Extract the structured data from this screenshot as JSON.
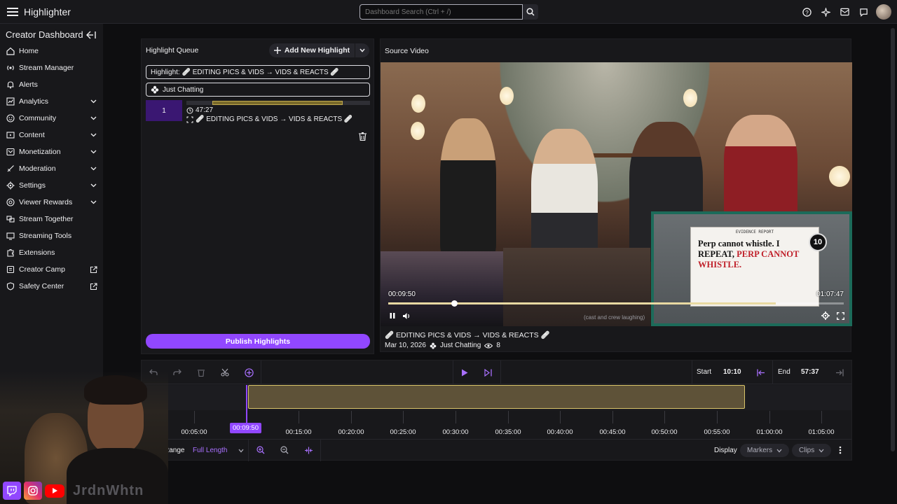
{
  "app": {
    "title": "Highlighter"
  },
  "search": {
    "placeholder": "Dashboard Search (Ctrl + /)"
  },
  "top_icons": [
    "help-icon",
    "sparkle-icon",
    "inbox-icon",
    "chat-icon",
    "avatar"
  ],
  "sidebar": {
    "title": "Creator Dashboard",
    "items": [
      {
        "label": "Home",
        "icon": "home-icon",
        "expandable": false
      },
      {
        "label": "Stream Manager",
        "icon": "stream-manager-icon",
        "expandable": false
      },
      {
        "label": "Alerts",
        "icon": "bell-icon",
        "expandable": false
      },
      {
        "label": "Analytics",
        "icon": "analytics-icon",
        "expandable": true
      },
      {
        "label": "Community",
        "icon": "community-icon",
        "expandable": true
      },
      {
        "label": "Content",
        "icon": "content-icon",
        "expandable": true
      },
      {
        "label": "Monetization",
        "icon": "monetization-icon",
        "expandable": true
      },
      {
        "label": "Moderation",
        "icon": "sword-icon",
        "expandable": true
      },
      {
        "label": "Settings",
        "icon": "gear-icon",
        "expandable": true
      },
      {
        "label": "Viewer Rewards",
        "icon": "rewards-icon",
        "expandable": true
      },
      {
        "label": "Stream Together",
        "icon": "stream-together-icon",
        "expandable": false
      },
      {
        "label": "Streaming Tools",
        "icon": "streaming-tools-icon",
        "expandable": false
      },
      {
        "label": "Extensions",
        "icon": "extensions-icon",
        "expandable": false
      },
      {
        "label": "Creator Camp",
        "icon": "creator-camp-icon",
        "external": true
      },
      {
        "label": "Safety Center",
        "icon": "shield-icon",
        "external": true
      }
    ]
  },
  "highlight_queue": {
    "title": "Highlight Queue",
    "add_label": "Add New Highlight",
    "highlight_field": "Highlight:  🩹 EDITING PICS & VIDS → VIDS & REACTS 🩹",
    "category_field": "Just Chatting",
    "items": [
      {
        "index": "1",
        "duration": "47:27",
        "name": "🩹 EDITING PICS & VIDS → VIDS & REACTS 🩹",
        "range_start": 0.14,
        "range_end": 0.85
      }
    ],
    "publish_label": "Publish Highlights"
  },
  "source_video": {
    "title": "Source Video",
    "current_time": "00:09:50",
    "total_time": "01:07:47",
    "progress": 0.145,
    "buffered": 0.85,
    "caption": "(cast and crew laughing)",
    "overlay_text_1": "Perp cannot whistle. I REPEAT, ",
    "overlay_text_red": "PERP CANNOT WHISTLE.",
    "overlay_header": "EVIDENCE REPORT",
    "overlay_badge": "10",
    "stream_title": "🩹 EDITING PICS & VIDS → VIDS & REACTS 🩹",
    "date": "Mar 10, 2026",
    "category": "Just Chatting",
    "views": "8"
  },
  "timeline": {
    "start_label": "Start",
    "start_value": "10:10",
    "end_label": "End",
    "end_value": "57:37",
    "playhead_label": "00:09:50",
    "ticks": [
      "00:05:00",
      "00:15:00",
      "00:20:00",
      "00:25:00",
      "00:30:00",
      "00:35:00",
      "00:40:00",
      "00:45:00",
      "00:50:00",
      "00:55:00",
      "01:00:00",
      "01:05:00"
    ],
    "range_label": "Range",
    "range_value": "Full Length",
    "display_label": "Display",
    "markers_label": "Markers",
    "clips_label": "Clips"
  },
  "webcam": {
    "handle": "JrdnWhtn"
  },
  "colors": {
    "accent": "#9147ff",
    "clip": "#5e5238",
    "clip_border": "#d8c46a"
  }
}
